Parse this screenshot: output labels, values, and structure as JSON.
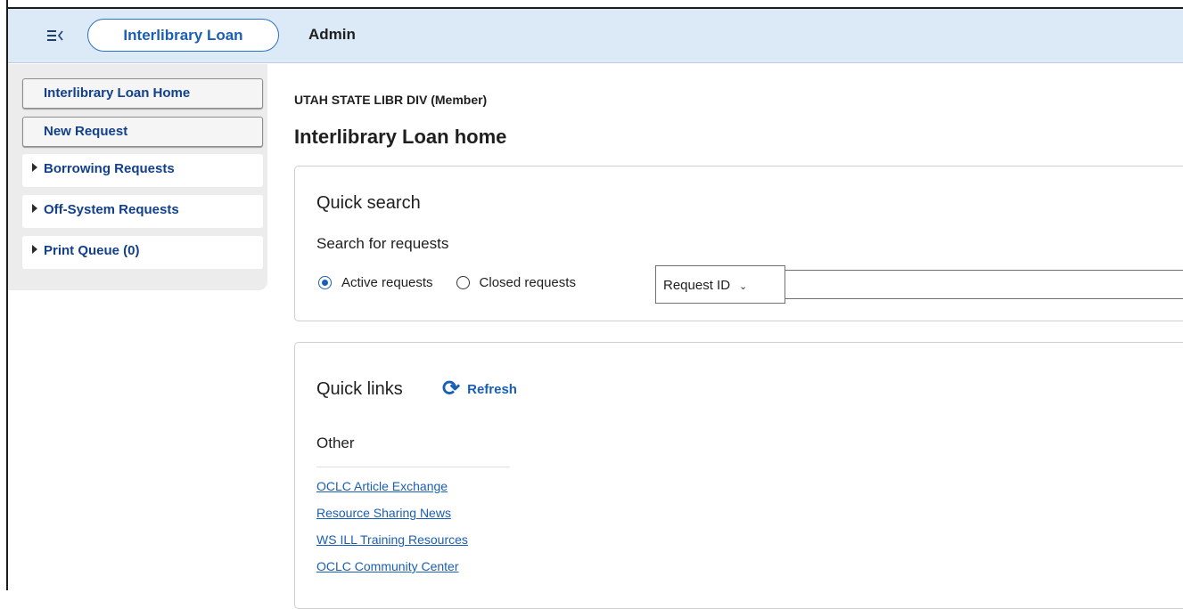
{
  "topbar": {
    "menu_icon": "menu-collapse-icon",
    "app_pill": "Interlibrary Loan",
    "admin": "Admin"
  },
  "sidebar": {
    "buttons": [
      "Interlibrary Loan Home",
      "New Request"
    ],
    "items": [
      {
        "label": "Borrowing Requests",
        "icon": "caret-right-icon"
      },
      {
        "label": "Off-System Requests",
        "icon": "caret-right-icon"
      },
      {
        "label": "Print Queue (0)",
        "icon": "caret-right-icon"
      }
    ]
  },
  "main": {
    "org": "UTAH STATE LIBR DIV (Member)",
    "title": "Interlibrary Loan home",
    "quick_search": {
      "title": "Quick search",
      "subtitle": "Search for requests",
      "radio_active": "Active requests",
      "radio_closed": "Closed requests",
      "selected_radio": "Active requests",
      "search_field": "Request ID",
      "search_value": ""
    },
    "quick_links": {
      "title": "Quick links",
      "refresh": "Refresh",
      "refresh_icon": "refresh-icon",
      "section": "Other",
      "links": [
        "OCLC Article Exchange",
        "Resource Sharing News",
        "WS ILL Training Resources",
        "OCLC Community Center"
      ]
    }
  },
  "colors": {
    "topbar_bg": "#dceaf8",
    "accent": "#1a5fb4",
    "sidebar_bg": "#ececec",
    "nav_text": "#12408a"
  }
}
